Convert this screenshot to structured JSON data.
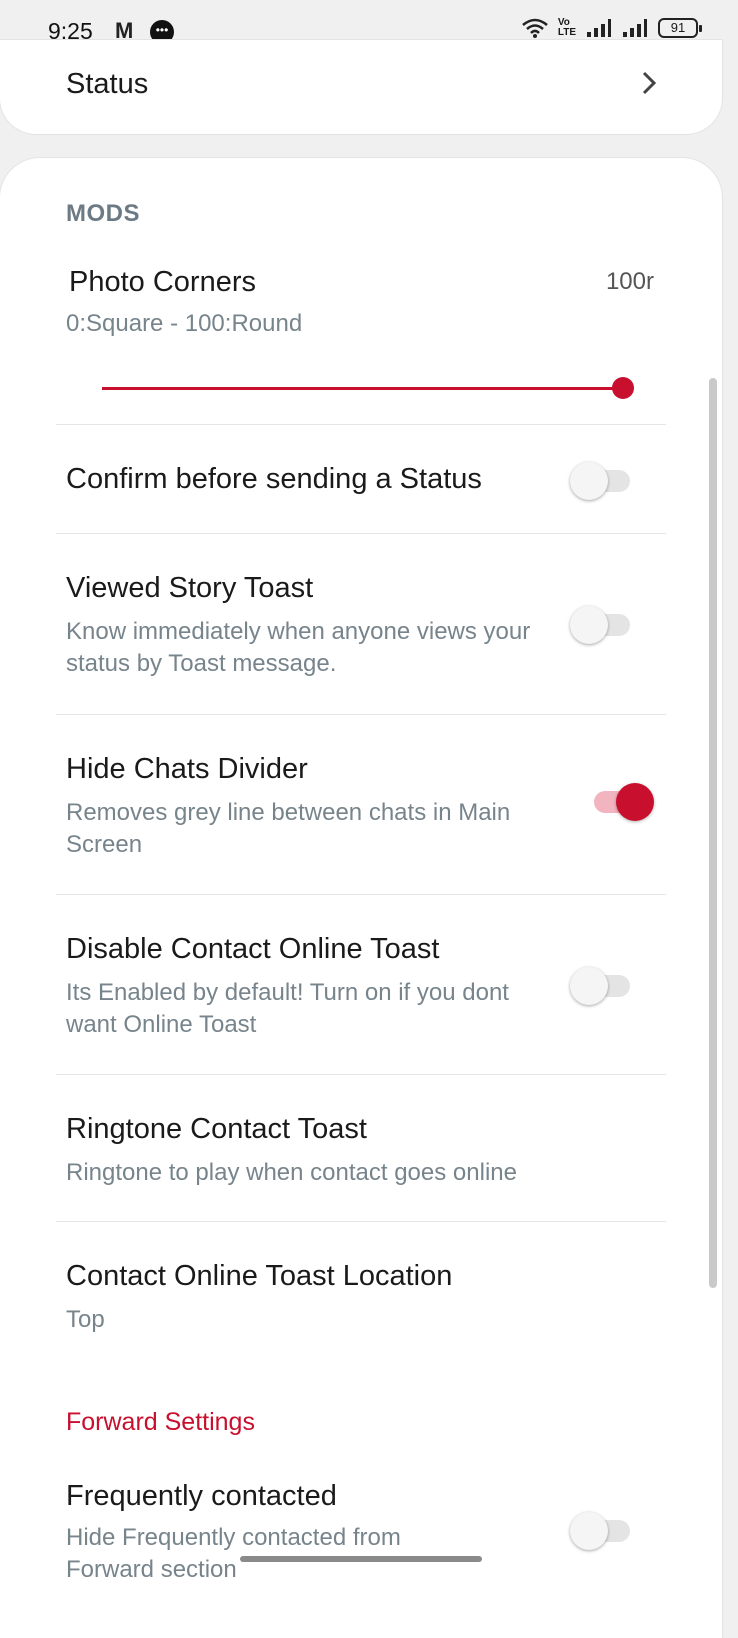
{
  "status_bar": {
    "time": "9:25",
    "gmail_icon_text": "M",
    "battery": "91"
  },
  "top_card": {
    "label": "Status"
  },
  "mods": {
    "section_title": "MODS",
    "photo_corners": {
      "title": "Photo Corners",
      "subtitle": "0:Square - 100:Round",
      "value_label": "100r",
      "value": 100,
      "min": 0,
      "max": 100
    },
    "items": [
      {
        "title": "Confirm before sending a Status",
        "subtitle": "",
        "toggle": false
      },
      {
        "title": "Viewed Story Toast",
        "subtitle": "Know immediately when anyone views your status by Toast message.",
        "toggle": false
      },
      {
        "title": "Hide Chats Divider",
        "subtitle": "Removes grey line between chats in Main Screen",
        "toggle": true
      },
      {
        "title": "Disable Contact Online Toast",
        "subtitle": "Its Enabled by default! Turn on if you dont want Online Toast",
        "toggle": false
      },
      {
        "title": "Ringtone Contact Toast",
        "subtitle": "Ringtone to play when contact goes online"
      },
      {
        "title": "Contact Online Toast Location",
        "subtitle": "Top"
      }
    ],
    "forward_section_title": "Forward Settings",
    "forward_items": [
      {
        "title": "Frequently contacted",
        "subtitle": "Hide Frequently contacted from Forward section",
        "toggle": false
      }
    ]
  },
  "colors": {
    "accent": "#c8102e",
    "subtext": "#77848c",
    "section": "#6b7a84"
  }
}
